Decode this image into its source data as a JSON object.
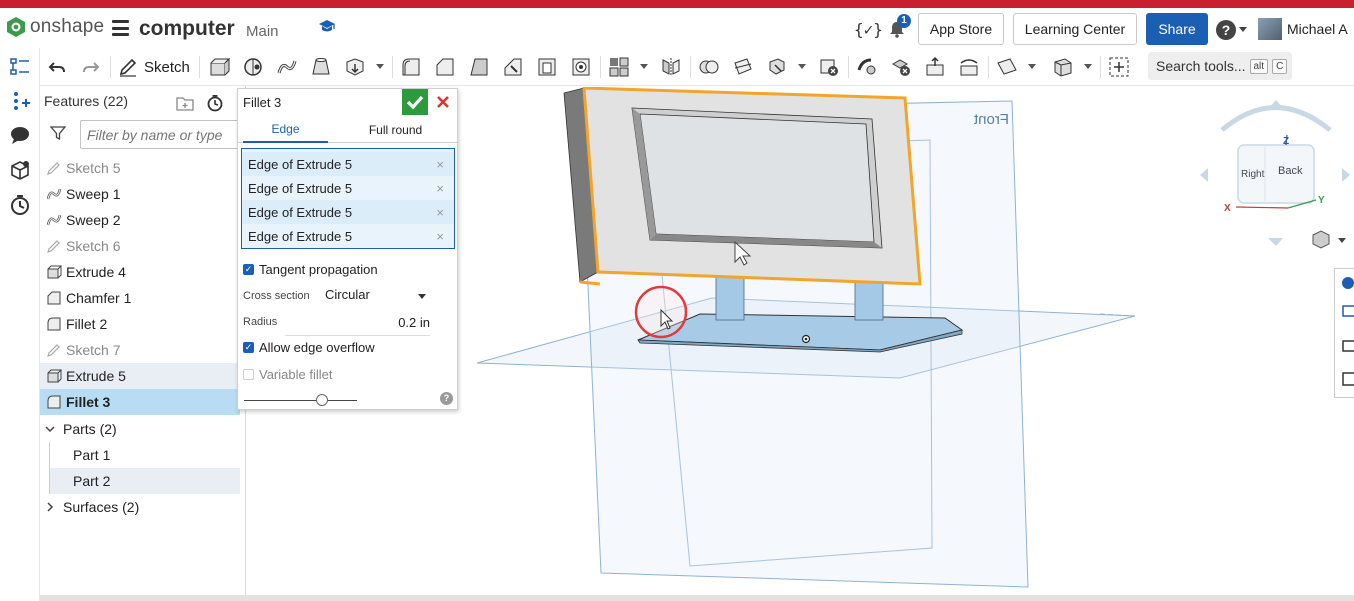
{
  "header": {
    "brand": "onshape",
    "document_name": "computer",
    "branch": "Main",
    "notifications_count": "1",
    "app_store_label": "App Store",
    "learning_center_label": "Learning Center",
    "share_label": "Share",
    "help_label": "?",
    "user_name": "Michael A",
    "variable_icon": "{✓}"
  },
  "toolbar": {
    "sketch_label": "Sketch",
    "search_label": "Search tools...",
    "search_key1": "alt",
    "search_key2": "C"
  },
  "features": {
    "title": "Features (22)",
    "filter_placeholder": "Filter by name or type",
    "items": [
      {
        "label": "Sketch 5",
        "icon": "sketch-icon"
      },
      {
        "label": "Sweep 1",
        "icon": "sweep-icon"
      },
      {
        "label": "Sweep 2",
        "icon": "sweep-icon"
      },
      {
        "label": "Sketch 6",
        "icon": "sketch-icon"
      },
      {
        "label": "Extrude 4",
        "icon": "extrude-icon"
      },
      {
        "label": "Chamfer 1",
        "icon": "chamfer-icon"
      },
      {
        "label": "Fillet 2",
        "icon": "fillet-icon"
      },
      {
        "label": "Sketch 7",
        "icon": "sketch-icon"
      },
      {
        "label": "Extrude 5",
        "icon": "extrude-icon"
      },
      {
        "label": "Fillet 3",
        "icon": "fillet-icon"
      }
    ],
    "parts_label": "Parts (2)",
    "parts": [
      "Part 1",
      "Part 2"
    ],
    "surfaces_label": "Surfaces (2)"
  },
  "fillet_panel": {
    "title": "Fillet 3",
    "tab_edge": "Edge",
    "tab_full_round": "Full round",
    "edges": [
      "Edge of Extrude 5",
      "Edge of Extrude 5",
      "Edge of Extrude 5",
      "Edge of Extrude 5"
    ],
    "remove_glyph": "×",
    "tangent_propagation_label": "Tangent propagation",
    "tangent_propagation_checked": true,
    "cross_section_label": "Cross section",
    "cross_section_value": "Circular",
    "radius_label": "Radius",
    "radius_value": "0.2 in",
    "allow_edge_overflow_label": "Allow edge overflow",
    "allow_edge_overflow_checked": true,
    "variable_fillet_label": "Variable fillet",
    "variable_fillet_checked": false,
    "slider_level": 0.69
  },
  "viewport": {
    "plane_label": "Front",
    "viewcube": {
      "top": "Z",
      "front": "Back",
      "right": "Right",
      "x_axis": "X",
      "y_axis": "Y"
    }
  },
  "colors": {
    "brand_red": "#c8202f",
    "accent_blue": "#1b5fb4",
    "selection_orange": "#f2a52a",
    "ok_green": "#2e9a3e",
    "cancel_red": "#d9362b",
    "part_blue": "#9fc8e6"
  }
}
